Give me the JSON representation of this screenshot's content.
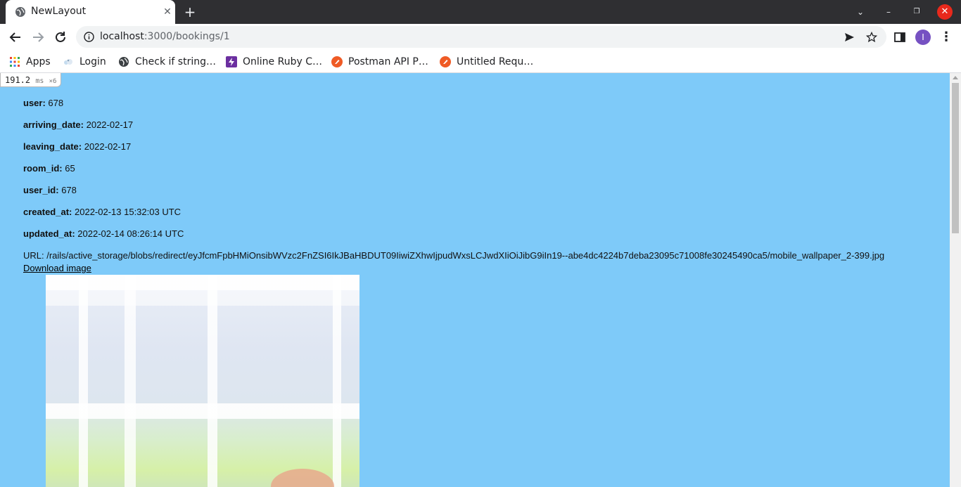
{
  "browser": {
    "tab_title": "NewLayout",
    "url_host": "localhost",
    "url_rest": ":3000/bookings/1",
    "avatar_letter": "I"
  },
  "bookmarks": [
    {
      "label": "Apps",
      "icon": "apps-grid-icon"
    },
    {
      "label": "Login",
      "icon": "login-icon"
    },
    {
      "label": "Check if string…",
      "icon": "globe-icon"
    },
    {
      "label": "Online Ruby C…",
      "icon": "lightning-icon"
    },
    {
      "label": "Postman API P…",
      "icon": "postman-icon"
    },
    {
      "label": "Untitled Requ…",
      "icon": "postman-icon"
    }
  ],
  "profiler": {
    "time": "191.2",
    "unit": "ms",
    "count": "×6"
  },
  "booking": {
    "user_label": "user:",
    "user": "678",
    "arriving_label": "arriving_date:",
    "arriving_date": "2022-02-17",
    "leaving_label": "leaving_date:",
    "leaving_date": "2022-02-17",
    "room_label": "room_id:",
    "room_id": "65",
    "user_id_label": "user_id:",
    "user_id": "678",
    "created_label": "created_at:",
    "created_at": "2022-02-13 15:32:03 UTC",
    "updated_label": "updated_at:",
    "updated_at": "2022-02-14 08:26:14 UTC",
    "url_line": "URL: /rails/active_storage/blobs/redirect/eyJfcmFpbHMiOnsibWVzc2FnZSI6IkJBaHBDUT09IiwiZXhwIjpudWxsLCJwdXIiOiJibG9iIn19--abe4dc4224b7deba23095c71008fe30245490ca5/mobile_wallpaper_2-399.jpg",
    "download_label": "Download image"
  },
  "colors": {
    "page_bg": "#7ecaf9",
    "titlebar_bg": "#2f2f32",
    "close_red": "#e8291c",
    "avatar_purple": "#7651c2"
  }
}
